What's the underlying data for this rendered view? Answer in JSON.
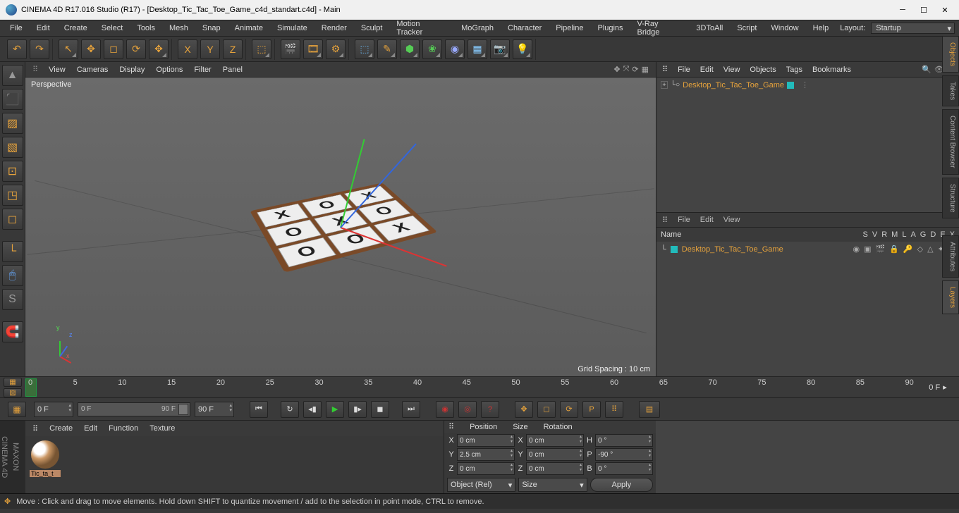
{
  "title": "CINEMA 4D R17.016 Studio (R17) - [Desktop_Tic_Tac_Toe_Game_c4d_standart.c4d] - Main",
  "menubar": [
    "File",
    "Edit",
    "Create",
    "Select",
    "Tools",
    "Mesh",
    "Snap",
    "Animate",
    "Simulate",
    "Render",
    "Sculpt",
    "Motion Tracker",
    "MoGraph",
    "Character",
    "Pipeline",
    "Plugins",
    "V-Ray Bridge",
    "3DToAll",
    "Script",
    "Window",
    "Help"
  ],
  "layout": {
    "label": "Layout:",
    "value": "Startup"
  },
  "viewport": {
    "menu": [
      "View",
      "Cameras",
      "Display",
      "Options",
      "Filter",
      "Panel"
    ],
    "label": "Perspective",
    "grid_spacing": "Grid Spacing : 10 cm",
    "board": [
      "X",
      "O",
      "X",
      "O",
      "X",
      "O",
      "O",
      "O",
      "X"
    ]
  },
  "side_tabs": [
    "Objects",
    "Takes",
    "Content Browser",
    "Structure",
    "Attributes",
    "Layers"
  ],
  "objects_panel": {
    "menu": [
      "File",
      "Edit",
      "View",
      "Objects",
      "Tags",
      "Bookmarks"
    ],
    "item": "Desktop_Tic_Tac_Toe_Game"
  },
  "layers_panel": {
    "menu": [
      "File",
      "Edit",
      "View"
    ],
    "head": "Name",
    "cols": [
      "S",
      "V",
      "R",
      "M",
      "L",
      "A",
      "G",
      "D",
      "E",
      "X"
    ],
    "item": "Desktop_Tic_Tac_Toe_Game"
  },
  "timeline": {
    "ticks": [
      "0",
      "5",
      "10",
      "15",
      "20",
      "25",
      "30",
      "35",
      "40",
      "45",
      "50",
      "55",
      "60",
      "65",
      "70",
      "75",
      "80",
      "85",
      "90"
    ],
    "end": "0 F",
    "range_start": "0 F",
    "slide_start": "0 F",
    "slide_end": "90 F",
    "range_end": "90 F"
  },
  "materials": {
    "menu": [
      "Create",
      "Edit",
      "Function",
      "Texture"
    ],
    "item": "Tic_ta_t"
  },
  "coords": {
    "head": [
      "Position",
      "Size",
      "Rotation"
    ],
    "rows": [
      {
        "a": "X",
        "pv": "0 cm",
        "b": "X",
        "sv": "0 cm",
        "c": "H",
        "rv": "0 °"
      },
      {
        "a": "Y",
        "pv": "2.5 cm",
        "b": "Y",
        "sv": "0 cm",
        "c": "P",
        "rv": "-90 °"
      },
      {
        "a": "Z",
        "pv": "0 cm",
        "b": "Z",
        "sv": "0 cm",
        "c": "B",
        "rv": "0 °"
      }
    ],
    "sel1": "Object (Rel)",
    "sel2": "Size",
    "apply": "Apply"
  },
  "status": "Move : Click and drag to move elements. Hold down SHIFT to quantize movement / add to the selection in point mode, CTRL to remove."
}
